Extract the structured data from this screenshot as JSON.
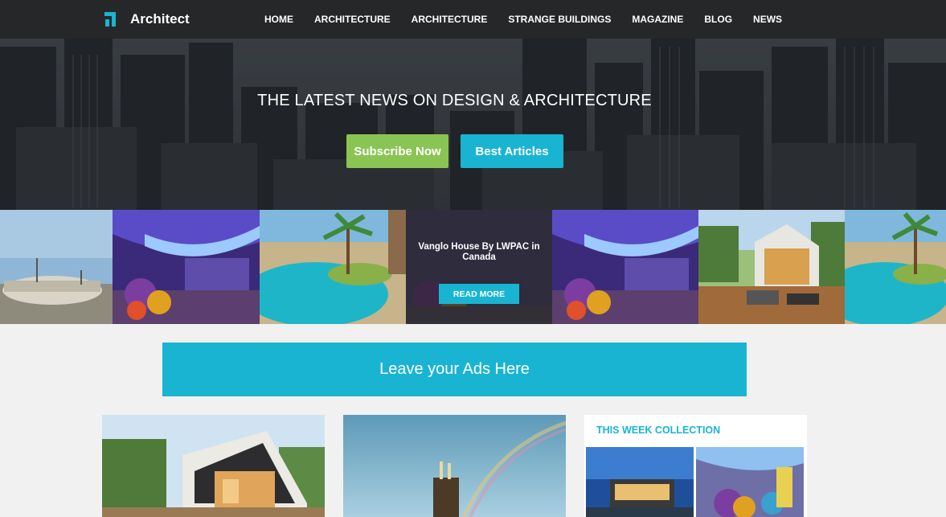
{
  "brand": {
    "name": "Architect",
    "accent": "#1ab4d3"
  },
  "nav": {
    "items": [
      "HOME",
      "ARCHITECTURE",
      "ARCHITECTURE",
      "STRANGE BUILDINGS",
      "MAGAZINE",
      "BLOG",
      "NEWS"
    ]
  },
  "hero": {
    "title": "THE LATEST NEWS ON DESIGN & ARCHITECTURE",
    "subscribe_label": "Subscribe Now",
    "best_label": "Best Articles",
    "subscribe_color": "#8ac554",
    "best_color": "#1ab4d3"
  },
  "strip": {
    "featured_caption": "Vanglo House By LWPAC in Canada",
    "read_more": "READ MORE"
  },
  "ads": {
    "text": "Leave your Ads Here"
  },
  "sidebar": {
    "title": "THIS WEEK COLLECTION"
  }
}
